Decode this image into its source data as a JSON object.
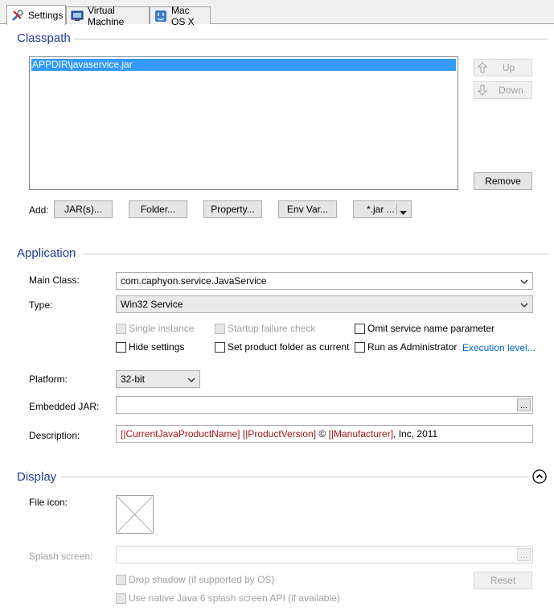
{
  "tabs": [
    {
      "label": "Settings",
      "icon": "wrench-screwdriver-icon"
    },
    {
      "label": "Virtual Machine",
      "icon": "virtual-machine-icon"
    },
    {
      "label": "Mac OS X",
      "icon": "mac-os-icon"
    }
  ],
  "classpath": {
    "title": "Classpath",
    "items": [
      "APPDIR\\javaservice.jar"
    ],
    "up_label": "Up",
    "down_label": "Down",
    "remove_label": "Remove",
    "add_label": "Add:",
    "add_buttons": [
      "JAR(s)...",
      "Folder...",
      "Property...",
      "Env Var...",
      "*.jar ..."
    ]
  },
  "application": {
    "title": "Application",
    "main_class_label": "Main Class:",
    "main_class_value": "com.caphyon.service.JavaService",
    "type_label": "Type:",
    "type_value": "Win32 Service",
    "checkboxes": {
      "single_instance": "Single instance",
      "startup_failure_check": "Startup failure check",
      "omit_service_name": "Omit service name parameter",
      "hide_settings": "Hide settings",
      "set_product_folder": "Set product folder as current",
      "run_as_admin": "Run as Administrator"
    },
    "execution_level_link": "Execution level...",
    "platform_label": "Platform:",
    "platform_value": "32-bit",
    "embedded_jar_label": "Embedded JAR:",
    "embedded_jar_value": "",
    "browse_label": "...",
    "description_label": "Description:",
    "description_parts": {
      "p1": "[|CurrentJavaProductName]",
      "p2": "[|ProductVersion]",
      "p3": "©",
      "p4": "[|Manufacturer]",
      "p5": ", Inc, 2011"
    }
  },
  "display": {
    "title": "Display",
    "file_icon_label": "File icon:",
    "splash_label": "Splash screen:",
    "splash_value": "",
    "browse_label": "...",
    "drop_shadow_label": "Drop shadow (if supported by OS)",
    "native_splash_label": "Use native Java 6 splash screen API (if available)",
    "reset_label": "Reset"
  }
}
